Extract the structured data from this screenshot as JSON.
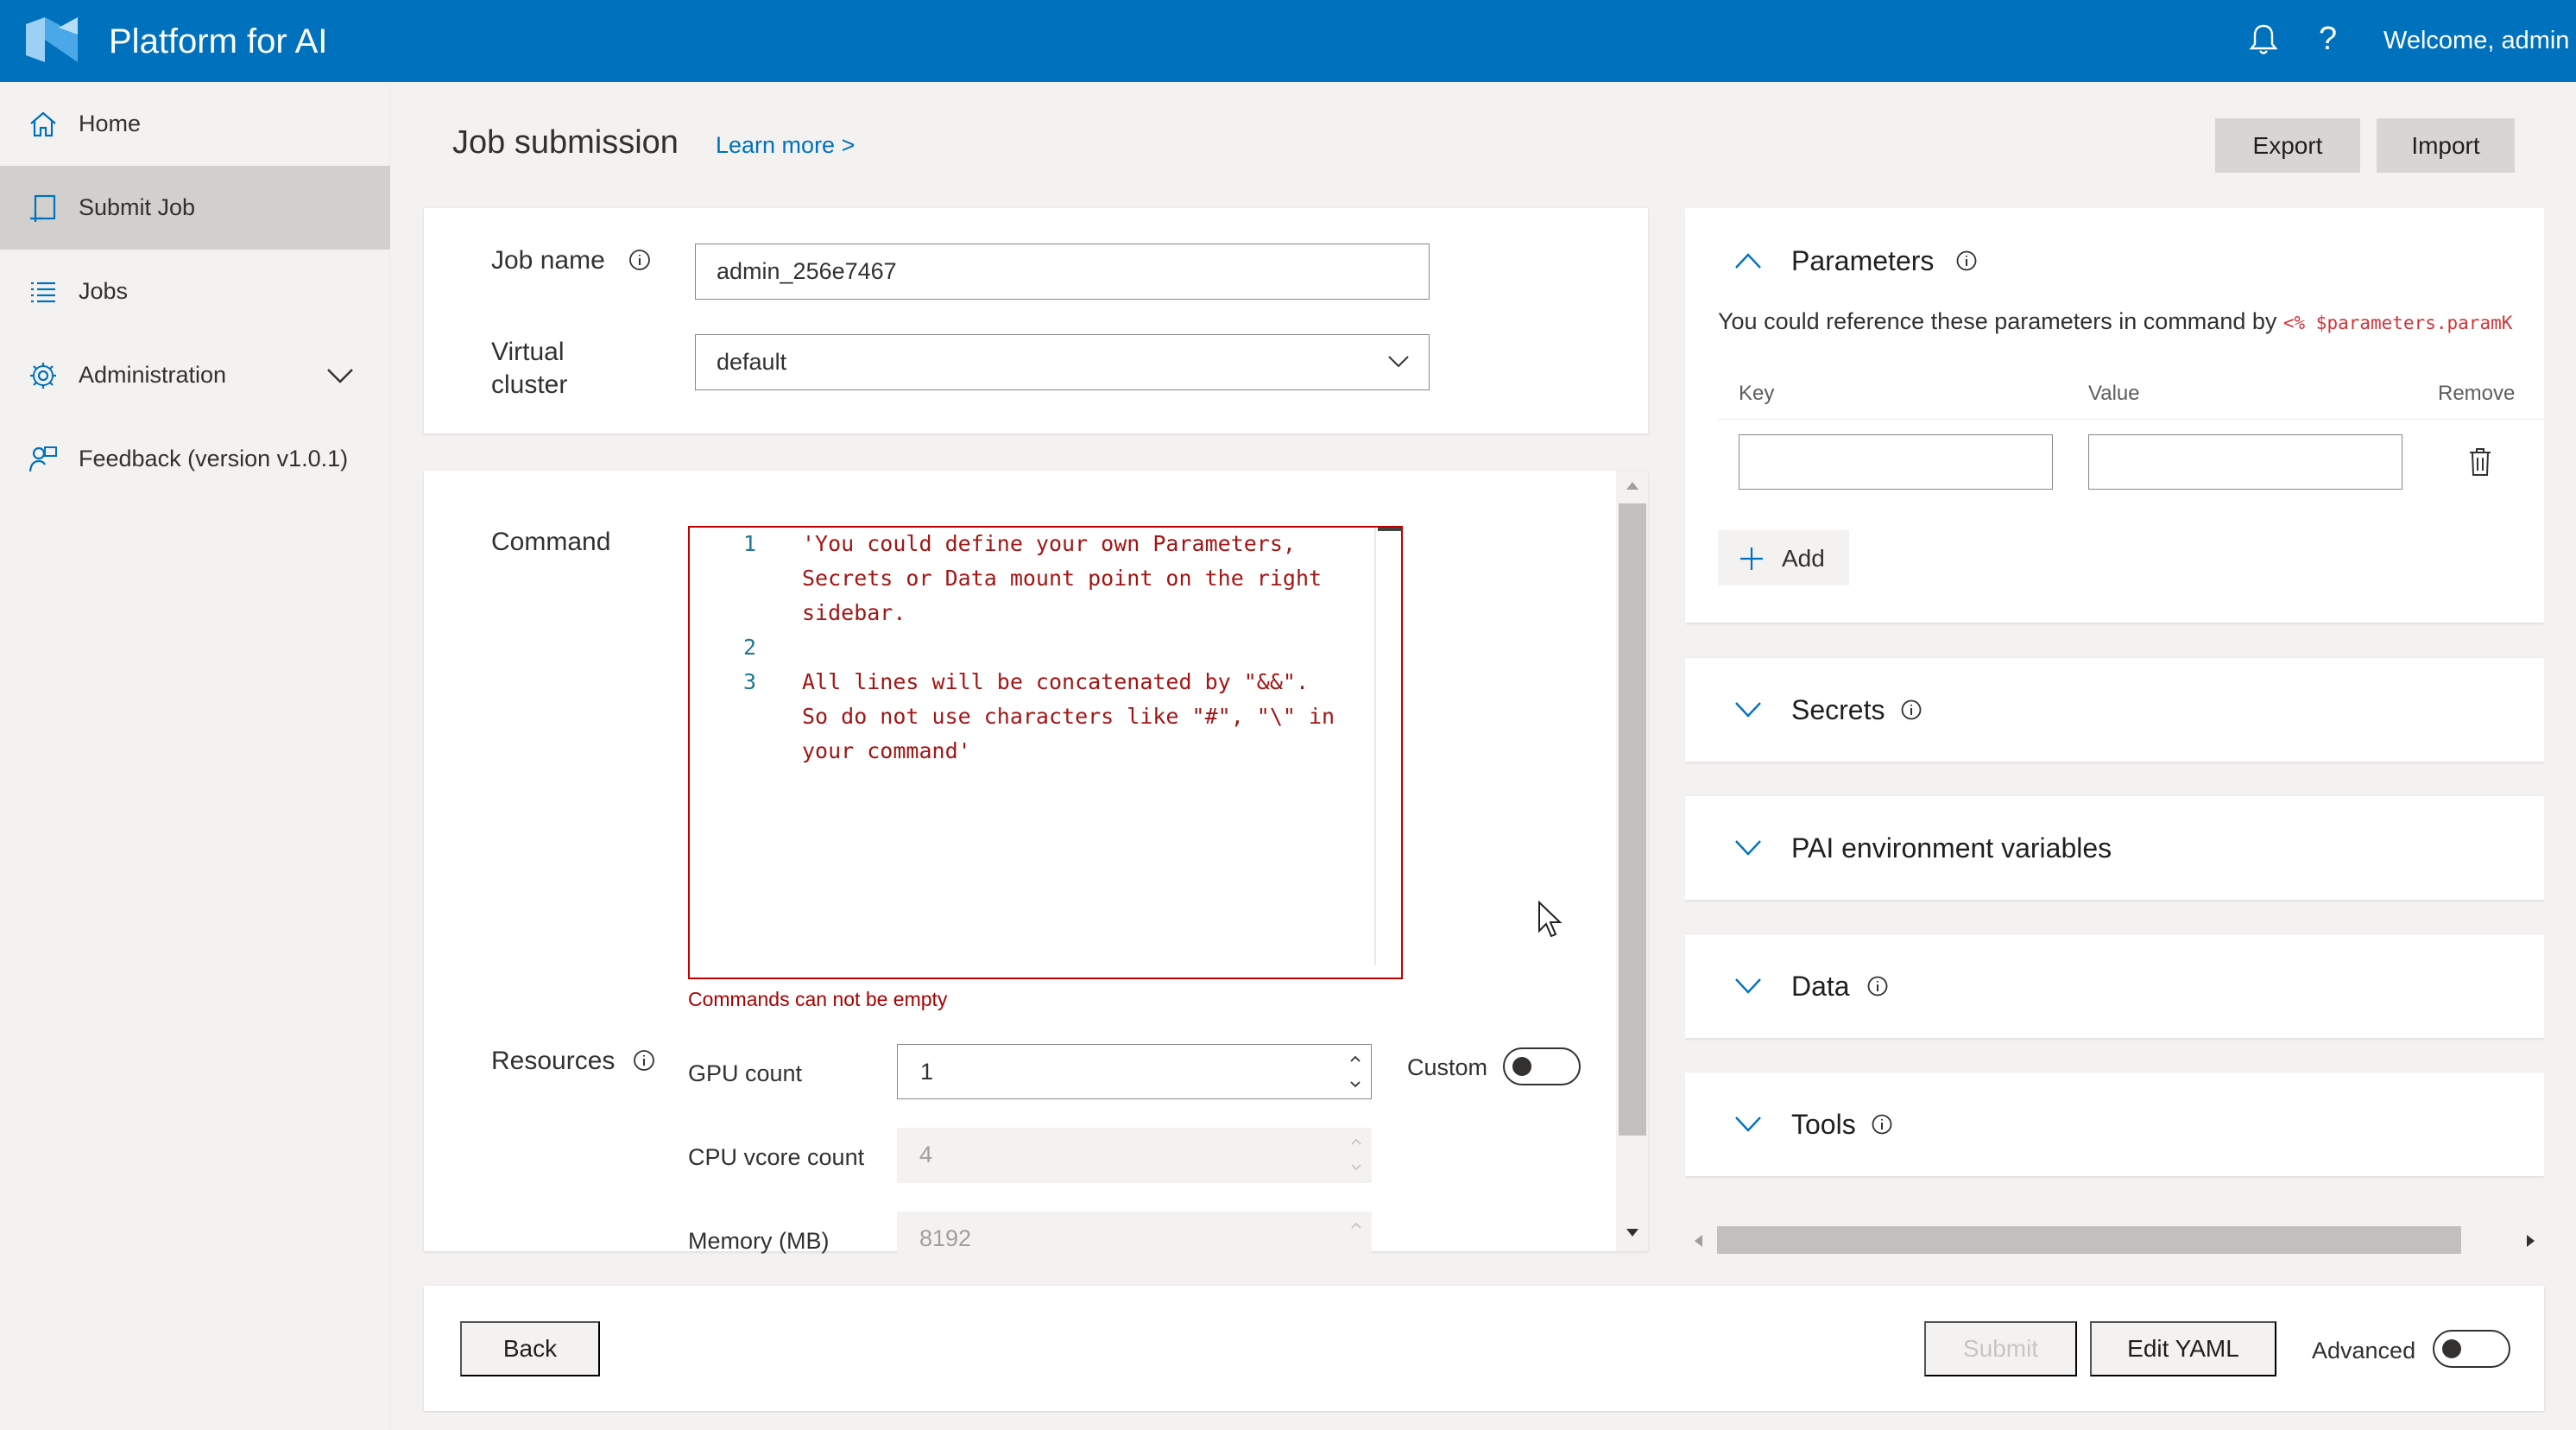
{
  "topbar": {
    "title": "Platform for AI",
    "help_glyph": "?",
    "welcome": "Welcome, admin",
    "bg_color": "#0071bc"
  },
  "sidebar": {
    "items": [
      {
        "label": "Home",
        "icon": "home-icon"
      },
      {
        "label": "Submit Job",
        "icon": "submit-job-icon",
        "active": true
      },
      {
        "label": "Jobs",
        "icon": "list-icon"
      },
      {
        "label": "Administration",
        "icon": "gear-icon",
        "expandable": true
      },
      {
        "label": "Feedback (version v1.0.1)",
        "icon": "feedback-icon"
      }
    ]
  },
  "header": {
    "title": "Job submission",
    "learn_more": "Learn more >",
    "export": "Export",
    "import": "Import"
  },
  "job": {
    "name_label": "Job name",
    "name_value": "admin_256e7467",
    "vc_label": "Virtual cluster",
    "vc_value": "default"
  },
  "command": {
    "label": "Command",
    "lines": [
      {
        "num": "1",
        "text": "'You could define your own Parameters,"
      },
      {
        "num": "",
        "text": "Secrets or Data mount point on the right"
      },
      {
        "num": "",
        "text": "sidebar."
      },
      {
        "num": "2",
        "text": ""
      },
      {
        "num": "3",
        "text": "All lines will be concatenated by \"&&\"."
      },
      {
        "num": "",
        "text": "So do not use characters like \"#\", \"\\\" in"
      },
      {
        "num": "",
        "text": "your command'"
      }
    ],
    "error": "Commands can not be empty",
    "error_color": "#a80000"
  },
  "resources": {
    "label": "Resources",
    "gpu_label": "GPU count",
    "gpu_value": "1",
    "cpu_label": "CPU vcore count",
    "cpu_value": "4",
    "mem_label": "Memory (MB)",
    "mem_value": "8192",
    "custom_label": "Custom",
    "custom_on": false
  },
  "parameters": {
    "title": "Parameters",
    "desc": "You could reference these parameters in command by ",
    "code": "<% $parameters.paramK",
    "col_key": "Key",
    "col_value": "Value",
    "col_remove": "Remove",
    "add": "Add"
  },
  "panels": {
    "secrets": "Secrets",
    "envvars": "PAI environment variables",
    "data": "Data",
    "tools": "Tools"
  },
  "bottom": {
    "back": "Back",
    "submit": "Submit",
    "edit_yaml": "Edit YAML",
    "advanced": "Advanced",
    "advanced_on": false
  }
}
